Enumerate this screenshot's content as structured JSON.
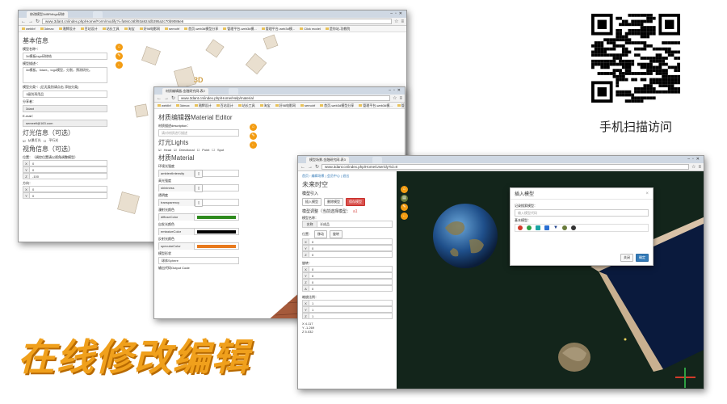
{
  "window1": {
    "tab_title": "修改模型3dBRdbgo研修",
    "url": "www.3dant.cn/index.php/Home/Form/modify?i=fa94cc6bf93a924db395a2c70b9086e6",
    "bookmarks": [
      "weblbf",
      "3dmax",
      "潮牌设计",
      "百站设计",
      "站长工具",
      "淘宝",
      "好98电影网",
      "semohf",
      "首页-web3d模型分享",
      "管理平台-web3d模...",
      "管理平台-web3d模...",
      "Click model",
      "是你站-功教院"
    ],
    "section_basic": "基本信息",
    "name_label": "模型名称*：",
    "name_value": "3d模板logo研修结",
    "desc_label": "模型描述*：",
    "desc_value": "3d模板，3dant，logo模型，分割，预测研究。",
    "category_label": "模型分类*：(后无类别请点击 添加分类)",
    "category_link": "添加分类",
    "category_value": "1级别再用品",
    "author_label": "分享者：",
    "author_value": "3dant",
    "email_label": "E-mail：",
    "email_value": "semeefi@163.com",
    "section_light": "灯光信息（可选）",
    "light_opt1": "从景灯光",
    "light_opt2": "平行光",
    "section_view": "视角信息（可选）",
    "pos_label": "位置：（调控位置请以视角调整模型）",
    "pos": {
      "x": "0",
      "y": "0",
      "z": "-100"
    },
    "dir_label": "方向：",
    "dir": {
      "x": "0",
      "y": "0"
    },
    "tools": [
      "⌂",
      "✎",
      "←"
    ]
  },
  "window2": {
    "tab_title": "材质编辑器-金融研究网-表2",
    "url": "www.3dant.cn/index.php/Home/Help/material",
    "bookmarks": [
      "weblbf",
      "3dmax",
      "潮牌设计",
      "百站设计",
      "站长工具",
      "淘宝",
      "好98电影网",
      "semohf",
      "首页-web3d模型分享",
      "管理平台-web3d模...",
      "管理平台-web3d模...",
      "Click model",
      "是你站-功教院"
    ],
    "title": "材质编辑器Material Editor",
    "desc_label": "材质描述description：",
    "desc_placeholder": "请对材质进行描述",
    "section_lights": "灯光Lights",
    "light_opts": [
      "Head",
      "Directional",
      "Point",
      "Spot"
    ],
    "section_material": "材质Material",
    "ambient_label": "环境光强度",
    "ambient_key": "ambientIntensity",
    "shininess_label": "高光强度",
    "shininess_key": "shininess",
    "transparency_label": "透明度",
    "transparency_key": "transparency",
    "diffuse_label": "漫射光颜色",
    "diffuse_key": "diffuseColor",
    "emissive_label": "自发光颜色",
    "emissive_key": "emissiveColor",
    "specular_label": "反射光颜色",
    "specular_key": "specularColor",
    "shape_label": "模型形状",
    "shape_value": "球体Sphere",
    "output_label": "输出代码Output Code",
    "colors": {
      "diffuse": "#2e8b1e",
      "emissive": "#000000",
      "specular": "#e87a1e"
    },
    "tools": [
      "⌂",
      "✎",
      "←"
    ]
  },
  "window3": {
    "tab_title": "模型场景-金融研究网-表3",
    "url": "www.3dant.cn/index.php/Home/User/dy?id=8",
    "breadcrumb": "首页 › 编辑场景 | 会员中心 | 退出",
    "title": "未来时空",
    "import_label": "模型引入",
    "btn_import": "插入模型",
    "btn_delete": "删除模型",
    "btn_save": "保存模型",
    "adjust_label": "模型调整（当前选择模型：",
    "adjust_value": "a1",
    "name_label": "模型名称：",
    "name_key": "名称",
    "name_value": "半成品",
    "pos_label": "位置：",
    "move_label": "移动",
    "rotate_label": "旋转",
    "pos": {
      "x": "0",
      "y": "0",
      "z": "0"
    },
    "rot_label": "旋转：",
    "rot": {
      "x": "0",
      "y": "0",
      "z": "0",
      "a": "0"
    },
    "scale_label": "缩放比例：",
    "scale": {
      "x": "1",
      "y": "1",
      "z": "1"
    },
    "coords": [
      "X 4.117",
      "Y -1.269",
      "Z 5.032"
    ],
    "tools": [
      "⌂",
      "▤",
      "✎",
      "←"
    ],
    "dialog": {
      "title": "插入模型",
      "search_label": "记录搜索模型：",
      "search_placeholder": "输入模型代码",
      "basic_label": "基本模型：",
      "cancel": "关闭",
      "ok": "确定"
    }
  },
  "qr_caption": "手机扫描访问",
  "slogan": "在线修改编辑"
}
